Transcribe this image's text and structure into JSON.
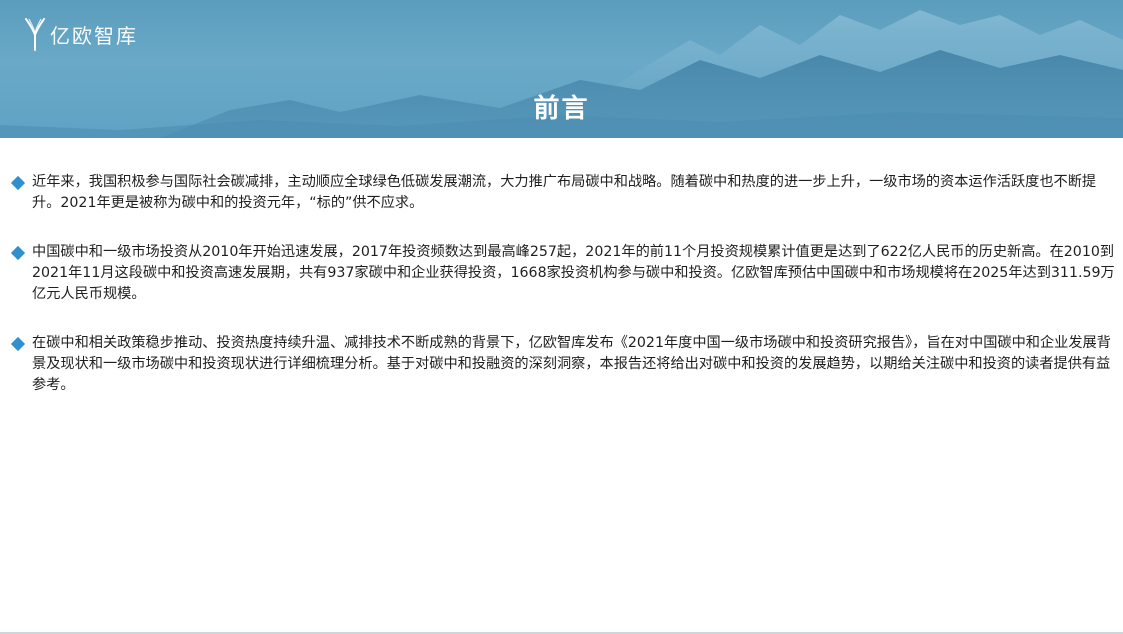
{
  "brand": {
    "logo_text": "亿欧智库"
  },
  "header": {
    "title": "前言"
  },
  "paragraphs": [
    "近年来，我国积极参与国际社会碳减排，主动顺应全球绿色低碳发展潮流，大力推广布局碳中和战略。随着碳中和热度的进一步上升，一级市场的资本运作活跃度也不断提升。2021年更是被称为碳中和的投资元年，“标的”供不应求。",
    "中国碳中和一级市场投资从2010年开始迅速发展，2017年投资频数达到最高峰257起，2021年的前11个月投资规模累计值更是达到了622亿人民币的历史新高。在2010到2021年11月这段碳中和投资高速发展期，共有937家碳中和企业获得投资，1668家投资机构参与碳中和投资。亿欧智库预估中国碳中和市场规模将在2025年达到311.59万亿元人民币规模。",
    "在碳中和相关政策稳步推动、投资热度持续升温、减排技术不断成熟的背景下，亿欧智库发布《2021年度中国一级市场碳中和投资研究报告》，旨在对中国碳中和企业发展背景及现状和一级市场碳中和投资现状进行详细梳理分析。基于对碳中和投融资的深刻洞察，本报告还将给出对碳中和投资的发展趋势，以期给关注碳中和投资的读者提供有益参考。"
  ],
  "colors": {
    "banner": "#5fa2c3",
    "bullet": "#2f8fcf",
    "text": "#1f1f1f"
  },
  "icons": {
    "logo": "yiou-logo-icon",
    "bullet": "diamond-bullet-icon"
  }
}
